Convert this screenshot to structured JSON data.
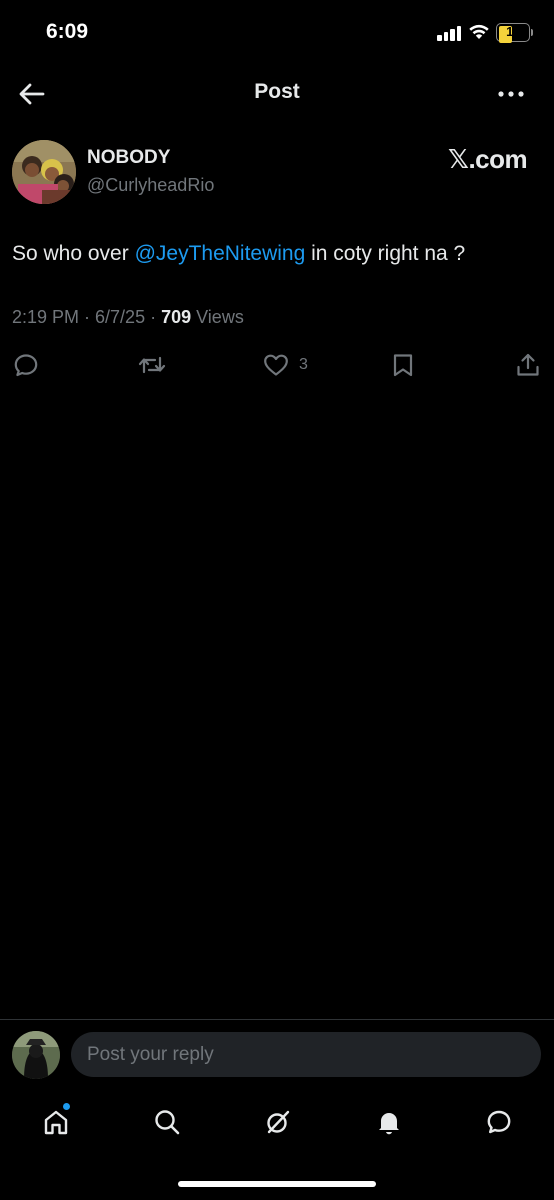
{
  "status_bar": {
    "time": "6:09",
    "battery_level": "11",
    "battery_color": "#f5d33b"
  },
  "header": {
    "title": "Post"
  },
  "post": {
    "author": {
      "display_name": "NOBODY",
      "handle": "@CurlyheadRio"
    },
    "watermark": "𝕏.com",
    "text_before": "So who over ",
    "mention": "@JeyTheNitewing",
    "text_after": " in coty right na ?",
    "timestamp": "2:19 PM · 6/7/25 · ",
    "views_count": "709",
    "views_label": " Views",
    "actions": {
      "reply_icon": "reply-icon",
      "repost_icon": "repost-icon",
      "like_icon": "heart-icon",
      "like_count": "3",
      "bookmark_icon": "bookmark-icon",
      "share_icon": "share-icon"
    }
  },
  "reply_bar": {
    "placeholder": "Post your reply"
  },
  "tab_bar": {
    "items": [
      "home-icon",
      "search-icon",
      "grok-icon",
      "notifications-icon",
      "messages-icon"
    ]
  },
  "colors": {
    "background": "#000000",
    "text_primary": "#e7e9ea",
    "text_secondary": "#71767b",
    "accent": "#1d9bf0"
  }
}
